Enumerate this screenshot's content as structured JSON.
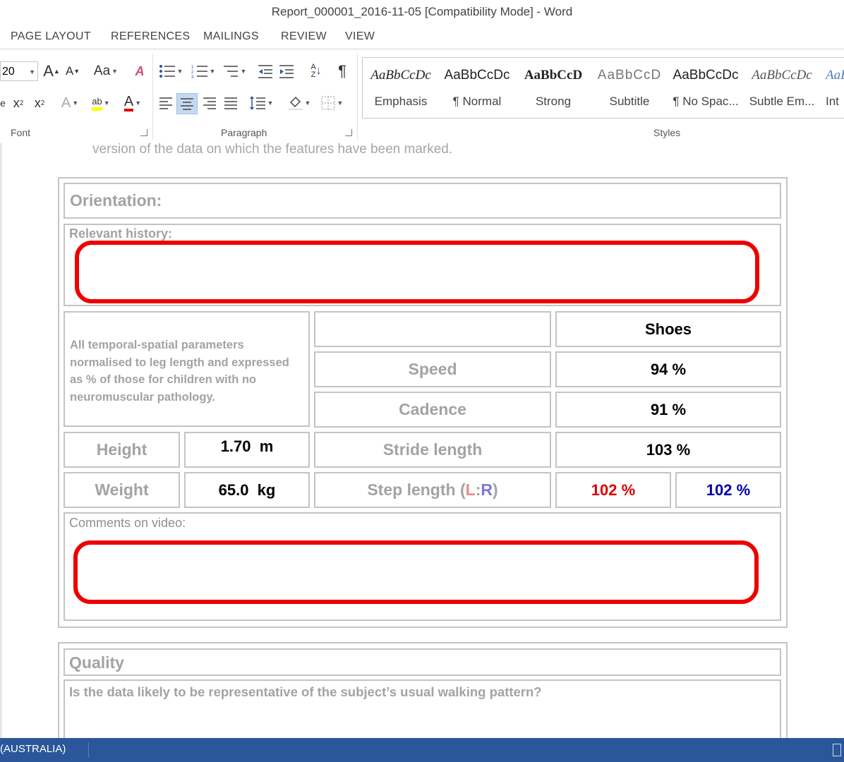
{
  "window": {
    "title": "Report_000001_2016-11-05 [Compatibility Mode] - Word"
  },
  "tabs": [
    "PAGE LAYOUT",
    "REFERENCES",
    "MAILINGS",
    "REVIEW",
    "VIEW"
  ],
  "ribbon": {
    "font": {
      "size": "20",
      "grow_label": "A",
      "shrink_label": "A",
      "case_label": "Aa",
      "sub_label": "x",
      "sub_suffix": "2",
      "sup_label": "x",
      "sup_suffix": "2",
      "effects_label": "A",
      "font_color_label": "A",
      "group_label": "Font"
    },
    "paragraph": {
      "group_label": "Paragraph",
      "pilcrow": "¶"
    },
    "styles": {
      "group_label": "Styles",
      "items": [
        {
          "sample": "AaBbCcDc",
          "name": "Emphasis"
        },
        {
          "sample": "AaBbCcDc",
          "name": "¶ Normal"
        },
        {
          "sample": "AaBbCcD",
          "name": "Strong"
        },
        {
          "sample": "AaBbCcD",
          "name": "Subtitle"
        },
        {
          "sample": "AaBbCcDc",
          "name": "¶ No Spac..."
        },
        {
          "sample": "AaBbCcDc",
          "name": "Subtle Em..."
        },
        {
          "sample": "AaB",
          "name": "Int"
        }
      ]
    }
  },
  "document": {
    "intro_text": "version of the data on which the features have been marked.",
    "orientation_label": "Orientation:",
    "relevant_history_label": "Relevant history:",
    "note": "All temporal-spatial parameters normalised to leg length and expressed as % of those for children with no neuromuscular pathology.",
    "shoes_header": "Shoes",
    "speed_label": "Speed",
    "speed_value": "94 %",
    "cadence_label": "Cadence",
    "cadence_value": "91 %",
    "height_label": "Height",
    "height_value": "1.70  m",
    "stride_label": "Stride length",
    "stride_value": "103 %",
    "weight_label": "Weight",
    "weight_value": "65.0  kg",
    "step_label_prefix": "Step length (",
    "step_label_l": "L",
    "step_label_sep": ":",
    "step_label_r": "R",
    "step_label_suffix": ")",
    "step_left_value": "102 %",
    "step_right_value": "102 %",
    "comments_label": "Comments on video:",
    "quality_label": "Quality",
    "quality_question": "Is the data likely to be representative of the subject’s usual walking pattern?"
  },
  "colors": {
    "left": "#dd0000",
    "right": "#0000aa",
    "left_label": "#e88a8a",
    "right_label": "#7a7ad8",
    "highlight_red": "#ee0000",
    "status_bar": "#2b579a"
  },
  "status": {
    "language": "(AUSTRALIA)"
  }
}
